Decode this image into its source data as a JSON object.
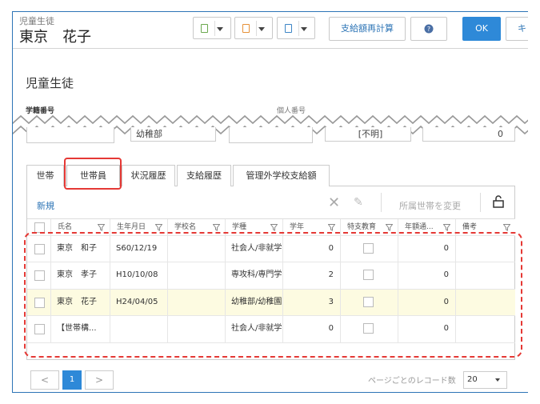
{
  "header": {
    "category": "児童生徒",
    "name": "東京　花子",
    "recalc_label": "支給額再計算",
    "ok_label": "OK",
    "cancel_label": "キ"
  },
  "section": {
    "title": "児童生徒",
    "field1_label": "学籍番号",
    "field2_label": "個人番号",
    "school_type_value": "幼稚部",
    "unknown_value": "[不明]",
    "last_value": "0"
  },
  "tabs": [
    "世帯",
    "世帯員",
    "状況履歴",
    "支給履歴",
    "管理外学校支給額"
  ],
  "toolbar": {
    "new_label": "新規",
    "move_label": "所属世帯を変更"
  },
  "columns": [
    "氏名",
    "生年月日",
    "学校名",
    "学種",
    "学年",
    "特支教育",
    "年額通...",
    "備考"
  ],
  "rows": [
    {
      "name": "東京　和子",
      "birth": "S60/12/19",
      "school": "",
      "type": "社会人/非就学",
      "grade": "0",
      "annual": "0",
      "note": ""
    },
    {
      "name": "東京　孝子",
      "birth": "H10/10/08",
      "school": "",
      "type": "専攻科/専門学",
      "grade": "2",
      "annual": "0",
      "note": ""
    },
    {
      "name": "東京　花子",
      "birth": "H24/04/05",
      "school": "",
      "type": "幼稚部/幼稚園",
      "grade": "3",
      "annual": "0",
      "note": ""
    },
    {
      "name": "【世帯構...",
      "birth": "",
      "school": "",
      "type": "社会人/非就学",
      "grade": "0",
      "annual": "0",
      "note": ""
    }
  ],
  "pager": {
    "prev": "<",
    "page": "1",
    "next": ">",
    "per_page_label": "ページごとのレコード数",
    "per_page_value": "20"
  },
  "icons": {
    "dropdown1": "clipboard-green-icon",
    "dropdown2": "clipboard-orange-icon",
    "dropdown3": "clipboard-blue-icon",
    "help": "help-icon",
    "delete": "x-icon",
    "edit": "pencil-icon",
    "lock": "unlock-icon"
  },
  "colors": {
    "accent": "#2e89d8",
    "highlight_row": "#fdfbe1",
    "annotation": "#e53935"
  }
}
